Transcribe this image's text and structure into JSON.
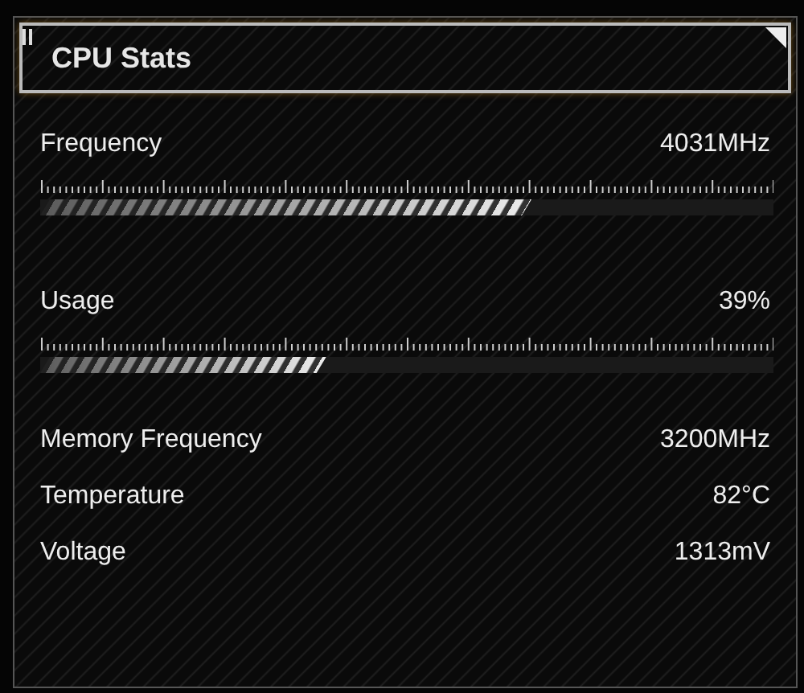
{
  "panel": {
    "title": "CPU Stats"
  },
  "meters": [
    {
      "label": "Frequency",
      "reading": "4031MHz",
      "level": 0.67
    },
    {
      "label": "Usage",
      "reading": "39%",
      "level": 0.39
    }
  ],
  "stats": [
    {
      "label": "Memory Frequency",
      "value": "3200MHz"
    },
    {
      "label": "Temperature",
      "value": "82°C"
    },
    {
      "label": "Voltage",
      "value": "1313mV"
    }
  ]
}
